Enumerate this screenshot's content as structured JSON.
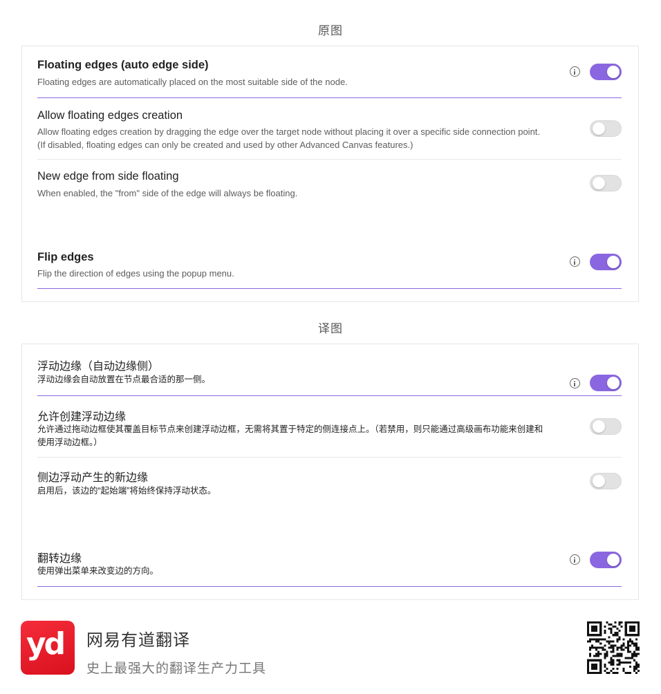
{
  "captions": {
    "original": "原图",
    "translated": "译图"
  },
  "original": {
    "floating_title": "Floating edges (auto edge side)",
    "floating_desc": "Floating edges are automatically placed on the most suitable side of the node.",
    "allow_title": "Allow floating edges creation",
    "allow_desc_1": "Allow floating edges creation by dragging the edge over the target node without placing it over a specific side connection point.",
    "allow_desc_2": "(If disabled, floating edges can only be created and used by other Advanced Canvas features.)",
    "newedge_title": "New edge from side floating",
    "newedge_desc": "When enabled, the \"from\" side of the edge will always be floating.",
    "flip_title": "Flip edges",
    "flip_desc": "Flip the direction of edges using the popup menu."
  },
  "translated": {
    "floating_title": "浮动边缘（自动边缘侧）",
    "floating_desc": "浮动边缘会自动放置在节点最合适的那一侧。",
    "allow_title": "允许创建浮动边缘",
    "allow_desc_1": "允许通过拖动边框使其覆盖目标节点来创建浮动边框，无需将其置于特定的侧连接点上。（若禁用，则只能通过高级画布功能来创建和",
    "allow_desc_2": "使用浮动边框。）",
    "newedge_title": "侧边浮动产生的新边缘",
    "newedge_desc": "启用后，该边的“起始端”将始终保持浮动状态。",
    "flip_title": "翻转边缘",
    "flip_desc": "使用弹出菜单来改变边的方向。"
  },
  "toggles": {
    "floating": true,
    "allow": false,
    "newedge": false,
    "flip": true
  },
  "icons": {
    "info": "info-icon"
  },
  "colors": {
    "accent": "#8a67e0",
    "brand_red": "#e81c2a"
  },
  "footer": {
    "logo_text": "yd",
    "title": "网易有道翻译",
    "subtitle": "史上最强大的翻译生产力工具"
  }
}
